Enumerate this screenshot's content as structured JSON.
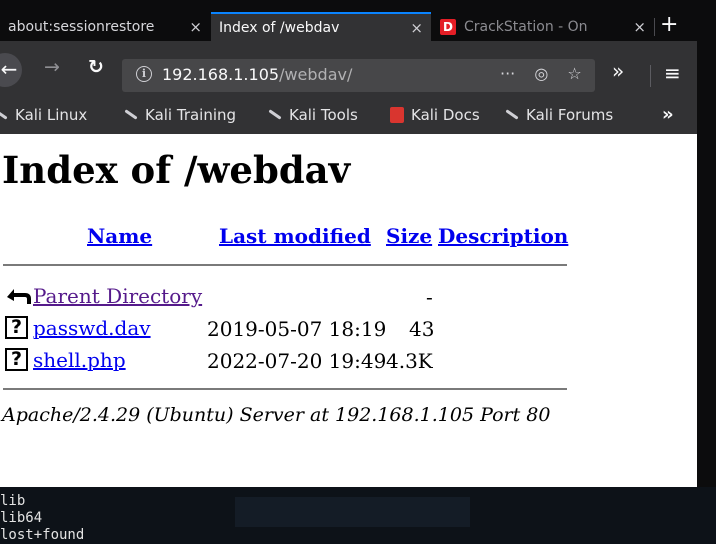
{
  "tabs": [
    {
      "label": "about:sessionrestore",
      "close": "×"
    },
    {
      "label": "Index of /webdav",
      "close": "×"
    },
    {
      "badge": "D",
      "label": "CrackStation - On",
      "close": "×"
    }
  ],
  "new_tab": "+",
  "nav": {
    "back": "←",
    "forward": "→",
    "reload": "↻",
    "url_host": "192.168.1.105",
    "url_path": "/webdav/",
    "url_more": "···",
    "pocket": "◎",
    "bookmark_star": "☆",
    "overflow": "»",
    "menu": "≡"
  },
  "bookmarks": [
    {
      "label": "Kali Linux",
      "icon": "kali-dragon-icon"
    },
    {
      "label": "Kali Training",
      "icon": "kali-dragon-icon"
    },
    {
      "label": "Kali Tools",
      "icon": "kali-dragon-icon"
    },
    {
      "label": "Kali Docs",
      "icon": "kali-docs-icon"
    },
    {
      "label": "Kali Forums",
      "icon": "kali-dragon-icon"
    }
  ],
  "bookmarks_more": "»",
  "page": {
    "title": "Index of /webdav",
    "headers": {
      "name": "Name",
      "last_modified": "Last modified",
      "size": "Size",
      "description": "Description"
    },
    "rows": [
      {
        "name": "Parent Directory",
        "date": "",
        "size": "-",
        "icon": "back-folder-icon"
      },
      {
        "name": "passwd.dav",
        "date": "2019-05-07 18:19",
        "size": "43",
        "icon": "unknown-file-icon"
      },
      {
        "name": "shell.php",
        "date": "2022-07-20 19:49",
        "size": "4.3K",
        "icon": "unknown-file-icon"
      }
    ],
    "footer": "Apache/2.4.29 (Ubuntu) Server at 192.168.1.105 Port 80"
  },
  "terminal": {
    "lines": [
      "lib",
      "lib64",
      "lost+found"
    ]
  },
  "colors": {
    "link": "#0000ee",
    "visited": "#551a8b",
    "accent": "#0a84ff"
  }
}
